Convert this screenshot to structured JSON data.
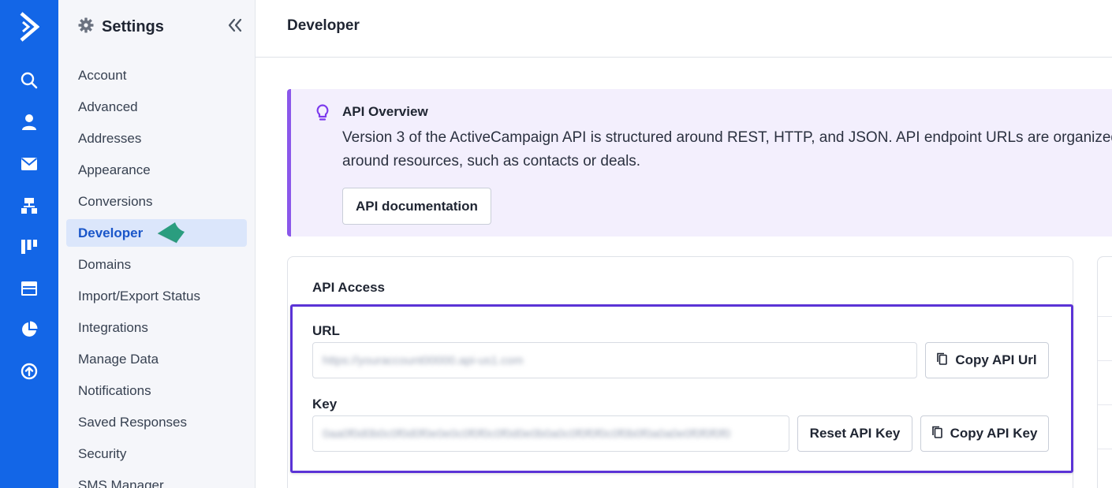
{
  "rail": {
    "items": [
      {
        "name": "logo",
        "icon": "activecampaign-logo-icon"
      },
      {
        "name": "search",
        "icon": "search-icon"
      },
      {
        "name": "contacts",
        "icon": "person-icon"
      },
      {
        "name": "campaigns",
        "icon": "envelope-icon"
      },
      {
        "name": "automations",
        "icon": "sitemap-icon"
      },
      {
        "name": "deals",
        "icon": "pipeline-icon"
      },
      {
        "name": "website",
        "icon": "browser-window-icon"
      },
      {
        "name": "reports",
        "icon": "pie-chart-icon"
      },
      {
        "name": "upgrade",
        "icon": "upload-circle-icon"
      }
    ],
    "bg_color": "#1366e7"
  },
  "sidebar": {
    "title": "Settings",
    "title_icon": "gear-icon",
    "collapse_icon": "double-chevron-left-icon",
    "items": [
      {
        "label": "Account"
      },
      {
        "label": "Advanced"
      },
      {
        "label": "Addresses"
      },
      {
        "label": "Appearance"
      },
      {
        "label": "Conversions"
      },
      {
        "label": "Developer",
        "active": true
      },
      {
        "label": "Domains"
      },
      {
        "label": "Import/Export Status"
      },
      {
        "label": "Integrations"
      },
      {
        "label": "Manage Data"
      },
      {
        "label": "Notifications"
      },
      {
        "label": "Saved Responses"
      },
      {
        "label": "Security"
      },
      {
        "label": "SMS Manager"
      }
    ],
    "active_color": "#1a56c9"
  },
  "page": {
    "title": "Developer"
  },
  "overview": {
    "icon": "lightbulb-icon",
    "title": "API Overview",
    "description": "Version 3 of the ActiveCampaign API is structured around REST, HTTP, and JSON. API endpoint URLs are organized around resources, such as contacts or deals.",
    "button_label": "API documentation",
    "accent_color": "#8a57ea"
  },
  "api_access": {
    "title": "API Access",
    "url_label": "URL",
    "url_value": "https://youraccount00000.api-us1.com",
    "copy_url_label": "Copy API Url",
    "key_label": "Key",
    "key_value": "0aa0f0d0b0c0f0d0f0e0e0c0f0f0c0f0d0e0b0a0c0f0f0f0c0f0b0f0a0a0e0f0f0f0f0",
    "reset_key_label": "Reset API Key",
    "copy_key_label": "Copy API Key",
    "copy_icon": "copy-icon",
    "highlight_color": "#5b33d6"
  },
  "annotation": {
    "arrow_icon": "pointer-arrow-icon",
    "color": "#2a9d7f"
  }
}
